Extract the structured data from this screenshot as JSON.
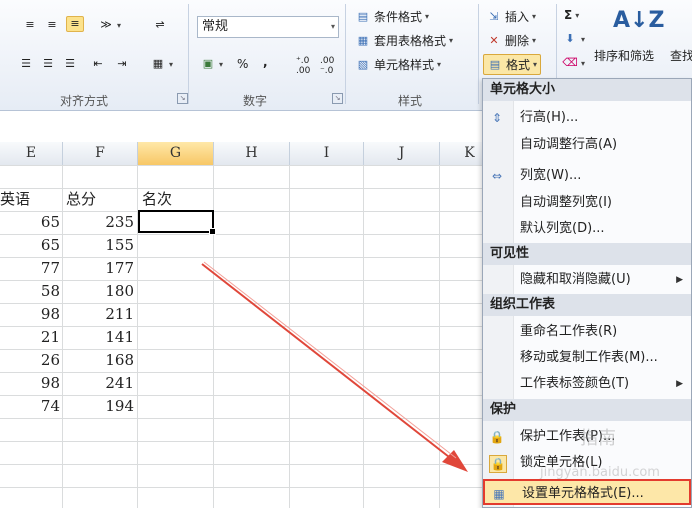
{
  "ribbon": {
    "style_combo_value": "常规",
    "group_labels": {
      "alignment": "对齐方式",
      "number": "数字",
      "styles": "样式"
    },
    "buttons": {
      "conditional_format": "条件格式",
      "table_format": "套用表格格式",
      "cell_styles": "单元格样式",
      "insert": "插入",
      "delete": "删除",
      "format": "格式",
      "sort_filter": "排序和筛选",
      "find": "查找",
      "percent": "%",
      "comma": ",",
      "sigma": "Σ"
    }
  },
  "grid": {
    "columns": [
      "E",
      "F",
      "G",
      "H",
      "I",
      "J",
      "K"
    ],
    "selected_column": "G",
    "header_labels": [
      "英语",
      "总分",
      "名次"
    ],
    "rows": [
      {
        "english": "65",
        "total": "235"
      },
      {
        "english": "65",
        "total": "155"
      },
      {
        "english": "77",
        "total": "177"
      },
      {
        "english": "58",
        "total": "180"
      },
      {
        "english": "98",
        "total": "211"
      },
      {
        "english": "21",
        "total": "141"
      },
      {
        "english": "26",
        "total": "168"
      },
      {
        "english": "98",
        "total": "241"
      },
      {
        "english": "74",
        "total": "194"
      }
    ]
  },
  "menu": {
    "section_cell_size": "单元格大小",
    "row_height": "行高(H)...",
    "autofit_row": "自动调整行高(A)",
    "col_width": "列宽(W)...",
    "autofit_col": "自动调整列宽(I)",
    "default_width": "默认列宽(D)...",
    "section_visibility": "可见性",
    "hide_unhide": "隐藏和取消隐藏(U)",
    "section_organize": "组织工作表",
    "rename": "重命名工作表(R)",
    "move_copy": "移动或复制工作表(M)...",
    "tab_color": "工作表标签颜色(T)",
    "section_protect": "保护",
    "protect_sheet": "保护工作表(P)...",
    "lock_cell": "锁定单元格(L)",
    "format_cells": "设置单元格格式(E)..."
  },
  "watermark": {
    "text": "指南",
    "url": "jingyan.baidu.com"
  },
  "colors": {
    "highlight_border": "#e33b2e",
    "arrow": "#e0473a",
    "selected_header": "#f7c766"
  },
  "icons": [
    "align-top-icon",
    "align-center-icon",
    "orientation-icon",
    "wrap-icon",
    "merge-icon",
    "currency-icon",
    "increase-decimal-icon",
    "decrease-decimal-icon",
    "conditional-format-icon",
    "table-format-icon",
    "cell-style-icon",
    "insert-icon",
    "delete-icon",
    "format-icon",
    "sum-icon",
    "fill-icon",
    "clear-icon",
    "sort-icon"
  ]
}
